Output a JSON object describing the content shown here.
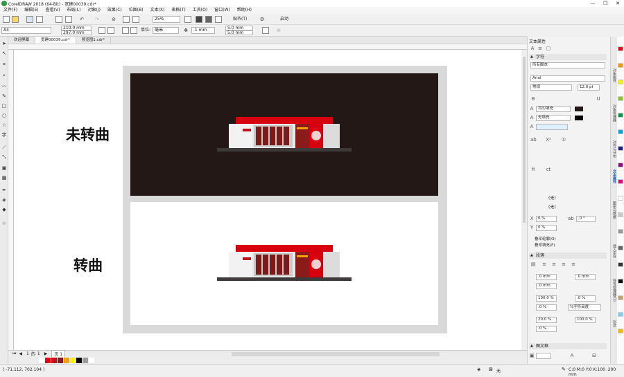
{
  "window": {
    "title": "CorelDRAW 2018 (64-Bit) - 宽建00039.cdr*",
    "controls": [
      "—",
      "❐",
      "✕"
    ]
  },
  "menu": [
    "文件(F)",
    "编辑(E)",
    "查看(V)",
    "布局(L)",
    "对象(J)",
    "效果(C)",
    "位图(B)",
    "文本(X)",
    "表格(T)",
    "工具(O)",
    "窗口(W)",
    "帮助(H)"
  ],
  "toolbar": {
    "zoom": "25%",
    "snap": "贴齐(T)",
    "launch": "启动"
  },
  "property_bar": {
    "page_size": "A4",
    "width": "210.0 mm",
    "height": "297.0 mm",
    "unit_label": "单位:",
    "unit": "毫米",
    "nudge": ".1 mm",
    "dup_x": "5.0 mm",
    "dup_y": "5.0 mm"
  },
  "tabs": [
    "欢迎屏幕",
    "宽建00039.cdr*",
    "预览图1.cdr*"
  ],
  "canvas": {
    "label_top": "未转曲",
    "label_bottom": "转曲",
    "top_bg": "#231815",
    "bottom_bg": "#ffffff",
    "frame": "#d9d9d9"
  },
  "page_nav": {
    "current": "1",
    "of_label": "的",
    "total": "1",
    "page_tab": "页 1"
  },
  "palette": [
    "#ffffff",
    "#e60012",
    "#c1121f",
    "#8b1a1a",
    "#f5a300",
    "#fff100",
    "#000000",
    "#9c9c9c",
    "#ffffff"
  ],
  "status": {
    "coords": "( -71.112, 702.104 )",
    "fill_none": "无",
    "color_info": "C:0 M:0 Y:0 K:100  .200 mm"
  },
  "docker": {
    "title": "文本属性",
    "char_section": "字符",
    "all_scripts": "所有脚本",
    "font": "Arial",
    "style": "常规",
    "size": "12.0 pt",
    "fill_type": "均匀填充",
    "bg_fill": "无填充",
    "none1": "(无)",
    "none2": "(无)",
    "x_offset": "0 %",
    "y_offset": "0 %",
    "rotation": ".0 °",
    "outline_label": "叠印轮廓(O)",
    "fill_label": "叠印填充(F)",
    "para_section": "段落",
    "indent1": ".0 mm",
    "indent2": ".0 mm",
    "indent3": ".0 mm",
    "spacing1": "100.0 %",
    "spacing2": ".0 %",
    "spacing3": ".0 %",
    "char_height": "%字符高度",
    "spacing4": "20.0 %",
    "spacing5": "100.0 %",
    "spacing6": ".0 %",
    "frame_section": "图文框",
    "frame_none": "无"
  },
  "side_tabs": [
    "对象属性",
    "对象管理器",
    "对齐与分布",
    "文本属性",
    "图形与数据",
    "插入字符",
    "符号管理器(O)",
    "形状"
  ],
  "color_strip": [
    "#e60012",
    "#f39800",
    "#fff100",
    "#8fc31f",
    "#009944",
    "#00a0e9",
    "#1d2088",
    "#920783",
    "#e4007f",
    "#ffffff",
    "#cccccc",
    "#999999",
    "#666666",
    "#333333",
    "#000000",
    "#c9a063",
    "#7ecef4",
    "#f8b500"
  ]
}
